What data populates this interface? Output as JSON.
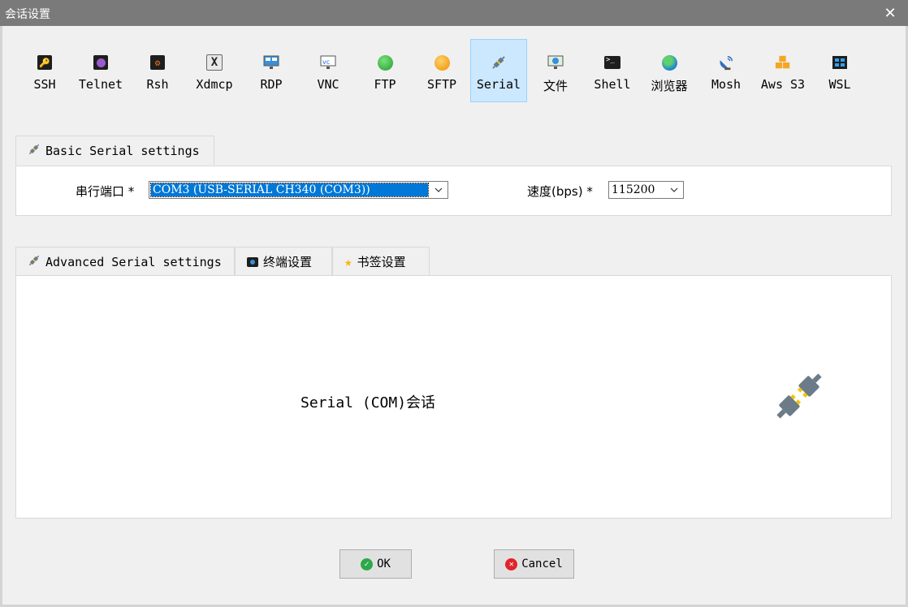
{
  "window": {
    "title": "会话设置",
    "close_glyph": "✕"
  },
  "toolbar": {
    "items": [
      {
        "label": "SSH",
        "icon": "ssh-key-icon"
      },
      {
        "label": "Telnet",
        "icon": "telnet-icon"
      },
      {
        "label": "Rsh",
        "icon": "rsh-icon"
      },
      {
        "label": "Xdmcp",
        "icon": "xdmcp-icon"
      },
      {
        "label": "RDP",
        "icon": "rdp-monitor-icon"
      },
      {
        "label": "VNC",
        "icon": "vnc-icon"
      },
      {
        "label": "FTP",
        "icon": "ftp-globe-icon"
      },
      {
        "label": "SFTP",
        "icon": "sftp-globe-icon"
      },
      {
        "label": "Serial",
        "icon": "serial-plug-icon",
        "active": true
      },
      {
        "label": "文件",
        "icon": "file-icon"
      },
      {
        "label": "Shell",
        "icon": "shell-terminal-icon"
      },
      {
        "label": "浏览器",
        "icon": "browser-globe-icon"
      },
      {
        "label": "Mosh",
        "icon": "mosh-satellite-icon"
      },
      {
        "label": "Aws S3",
        "icon": "aws-s3-cubes-icon"
      },
      {
        "label": "WSL",
        "icon": "wsl-windows-icon"
      }
    ]
  },
  "basic": {
    "tab_label": "Basic Serial settings",
    "port_label": "串行端口 *",
    "port_value": "COM3  (USB-SERIAL CH340 (COM3))",
    "speed_label": "速度(bps) *",
    "speed_value": "115200"
  },
  "advanced_tabs": [
    {
      "label": "Advanced Serial settings",
      "icon": "serial-plug-icon"
    },
    {
      "label": "终端设置",
      "icon": "terminal-settings-icon"
    },
    {
      "label": "书签设置",
      "icon": "star-icon"
    }
  ],
  "content": {
    "description": "Serial (COM)会话"
  },
  "buttons": {
    "ok": "OK",
    "cancel": "Cancel"
  },
  "colors": {
    "selection": "#0078d7",
    "active_tool": "#cce8ff",
    "ok": "#2ea84a",
    "cancel": "#e0242b"
  }
}
